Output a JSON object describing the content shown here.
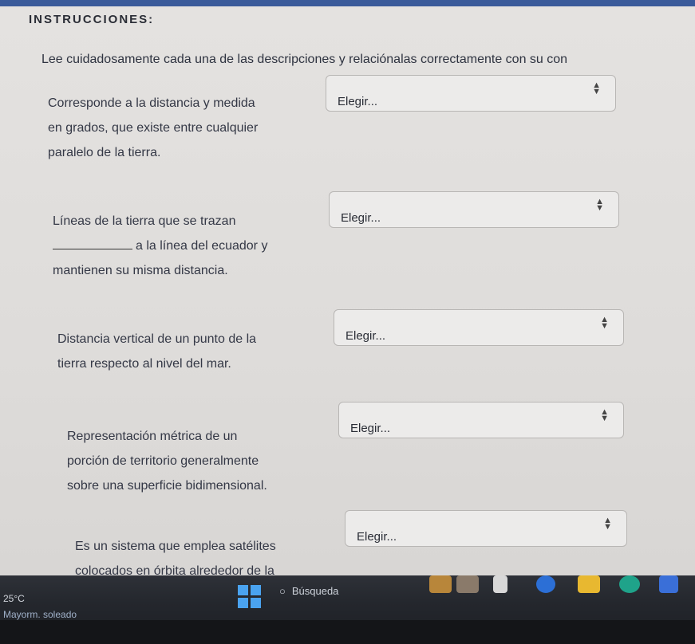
{
  "heading": "INSTRUCCIONES:",
  "intro": "Lee cuidadosamente cada una de las descripciones y relaciónalas correctamente con su con",
  "questions": [
    {
      "lines": [
        "Corresponde a la distancia y medida",
        "en grados, que existe entre cualquier",
        "paralelo de la tierra."
      ],
      "select": "Elegir..."
    },
    {
      "lines": [
        "Líneas de la tierra que se trazan",
        "a la línea del ecuador y",
        "mantienen su misma distancia."
      ],
      "select": "Elegir..."
    },
    {
      "lines": [
        "Distancia vertical de un punto de la",
        "tierra respecto al nivel del mar."
      ],
      "select": "Elegir..."
    },
    {
      "lines": [
        "Representación métrica de un",
        "porción de territorio generalmente",
        "sobre una superficie bidimensional."
      ],
      "select": "Elegir..."
    },
    {
      "lines": [
        "Es un sistema que emplea satélites",
        "colocados en órbita alrededor de la"
      ],
      "select": "Elegir..."
    }
  ],
  "taskbar": {
    "temperature": "25°C",
    "weather": "Mayorm. soleado",
    "search_label": "Búsqueda"
  }
}
